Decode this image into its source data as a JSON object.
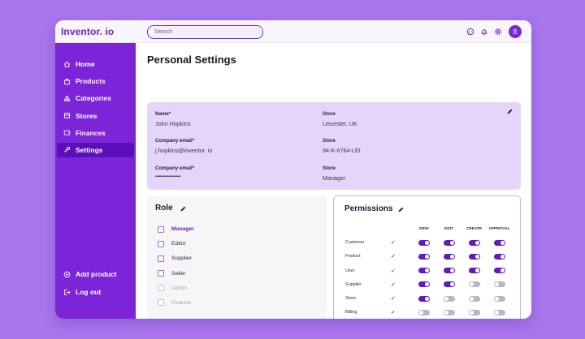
{
  "app": {
    "brand": "Inventor. io",
    "search": {
      "placeholder": "Search"
    }
  },
  "colors": {
    "accent": "#7b24d8",
    "accent_dark": "#5b0fb8",
    "card": "#e6d5fa",
    "background": "#a877ee"
  },
  "topbar_icons": [
    "chat-icon",
    "bell-icon",
    "gear-icon",
    "user-icon"
  ],
  "sidebar": {
    "items": [
      {
        "label": "Home",
        "icon": "home-icon",
        "active": false
      },
      {
        "label": "Products",
        "icon": "bag-icon",
        "active": false
      },
      {
        "label": "Categories",
        "icon": "shapes-icon",
        "active": false
      },
      {
        "label": "Stores",
        "icon": "store-icon",
        "active": false
      },
      {
        "label": "Finances",
        "icon": "wallet-icon",
        "active": false
      },
      {
        "label": "Settings",
        "icon": "wrench-icon",
        "active": true
      }
    ],
    "bottom": [
      {
        "label": "Add product",
        "icon": "plus-circle-icon"
      },
      {
        "label": "Log out",
        "icon": "logout-icon"
      }
    ]
  },
  "page": {
    "title": "Personal Settings"
  },
  "info": {
    "name_label": "Name*",
    "name_value": "John Hopkins",
    "email_label": "Company email*",
    "email_value": "j.hopkins@inventor. io",
    "password_label": "Company email*",
    "password_value": "•••••••••••••••••••••••••••",
    "store1_label": "Store",
    "store1_value": "Leicester, UK",
    "store2_label": "Store",
    "store2_value": "94-K-6764-LEI",
    "store3_label": "Store",
    "store3_value": "Manager"
  },
  "role": {
    "title": "Role",
    "items": [
      {
        "label": "Manager",
        "state": "selected"
      },
      {
        "label": "Editor",
        "state": "normal"
      },
      {
        "label": "Supplier",
        "state": "normal"
      },
      {
        "label": "Seller",
        "state": "normal"
      },
      {
        "label": "Admin",
        "state": "disabled"
      },
      {
        "label": "Finance",
        "state": "disabled"
      }
    ]
  },
  "permissions": {
    "title": "Permissions",
    "columns": [
      "VIEW",
      "EDIT",
      "CREATE",
      "APPROVAL"
    ],
    "check_glyph": "✓",
    "rows": [
      {
        "name": "Customer",
        "values": [
          true,
          true,
          true,
          true
        ]
      },
      {
        "name": "Product",
        "values": [
          true,
          true,
          true,
          true
        ]
      },
      {
        "name": "User",
        "values": [
          true,
          true,
          true,
          true
        ]
      },
      {
        "name": "Supplier",
        "values": [
          true,
          true,
          false,
          false
        ]
      },
      {
        "name": "Store",
        "values": [
          true,
          false,
          false,
          false
        ]
      },
      {
        "name": "Billing",
        "values": [
          false,
          false,
          false,
          false
        ]
      }
    ]
  }
}
